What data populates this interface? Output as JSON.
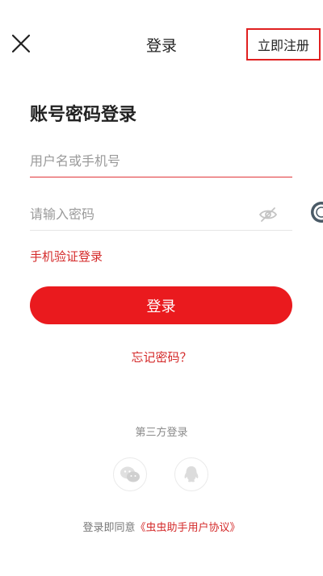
{
  "header": {
    "title": "登录",
    "register_label": "立即注册"
  },
  "form": {
    "heading": "账号密码登录",
    "username_placeholder": "用户名或手机号",
    "password_placeholder": "请输入密码",
    "sms_login_label": "手机验证登录",
    "login_button_label": "登录",
    "forgot_password_label": "忘记密码？"
  },
  "third_party": {
    "title": "第三方登录",
    "options": [
      {
        "icon": "wechat-icon"
      },
      {
        "icon": "qq-icon"
      }
    ]
  },
  "agreement": {
    "prefix": "登录即同意",
    "link_label": "《虫虫助手用户协议》"
  },
  "icons": {
    "close": "close-icon",
    "password_visibility": "eye-off-icon",
    "floating": "floating-assistant-icon"
  },
  "colors": {
    "accent": "#ea1a1e",
    "link": "#d42a2a",
    "highlight_border": "#e02020"
  }
}
